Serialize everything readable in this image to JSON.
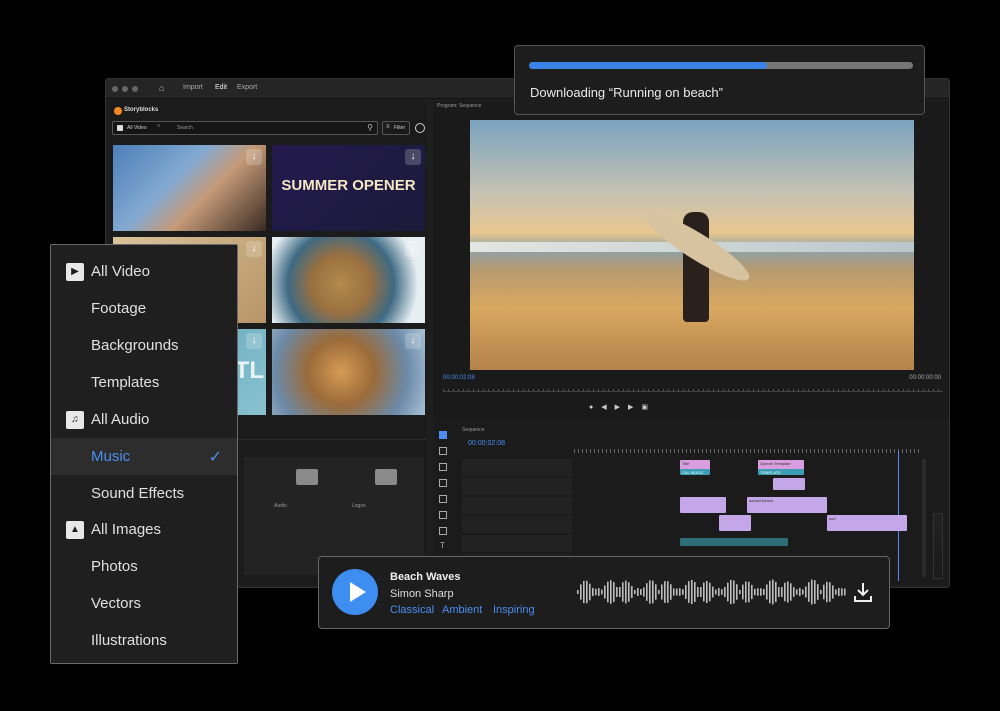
{
  "app": {
    "menu": [
      "Import",
      "Edit",
      "Export"
    ],
    "brand": "Storyblocks",
    "search": {
      "category": "All Video",
      "placeholder": "Search",
      "filter_label": "Filter"
    },
    "thumbnails": [
      {
        "label": ""
      },
      {
        "label": "SUMMER OPENER"
      },
      {
        "label": ""
      },
      {
        "label": ""
      },
      {
        "label": "ITL"
      },
      {
        "label": ""
      }
    ],
    "folders": [
      {
        "label": "Audio"
      },
      {
        "label": "Logos"
      }
    ],
    "program": {
      "title": "Program: Sequence",
      "timecode_left": "00:00:02:08",
      "timecode_right": "00:00:00:00"
    },
    "timeline": {
      "title": "Sequence",
      "timecode": "00:00:02:08",
      "clips": [
        {
          "label": "Title"
        },
        {
          "label": "Opener Template"
        },
        {
          "label": "CAL MUSIC TITLE"
        },
        {
          "label": "TEMPLATE"
        },
        {
          "label": ""
        },
        {
          "label": ""
        },
        {
          "label": "sunset beach"
        },
        {
          "label": ""
        },
        {
          "label": "surf"
        },
        {
          "label": ""
        }
      ]
    }
  },
  "download": {
    "text": "Downloading “Running on beach”",
    "progress": 0.62,
    "colors": {
      "fill": "#3b82e6",
      "track": "#777777"
    }
  },
  "dropdown": {
    "items": [
      {
        "label": "All Video",
        "icon": "play-box-icon",
        "selected": false
      },
      {
        "label": "Footage",
        "selected": false
      },
      {
        "label": "Backgrounds",
        "selected": false
      },
      {
        "label": "Templates",
        "selected": false
      },
      {
        "label": "All Audio",
        "icon": "music-note-icon",
        "selected": false
      },
      {
        "label": "Music",
        "selected": true
      },
      {
        "label": "Sound Effects",
        "selected": false
      },
      {
        "label": "All Images",
        "icon": "image-icon",
        "selected": false
      },
      {
        "label": "Photos",
        "selected": false
      },
      {
        "label": "Vectors",
        "selected": false
      },
      {
        "label": "Illustrations",
        "selected": false
      }
    ],
    "check": "✓"
  },
  "audio_card": {
    "title": "Beach Waves",
    "artist": "Simon Sharp",
    "tags": [
      "Classical",
      "Ambient",
      "Inspiring"
    ],
    "accent": "#3d8ef0"
  }
}
